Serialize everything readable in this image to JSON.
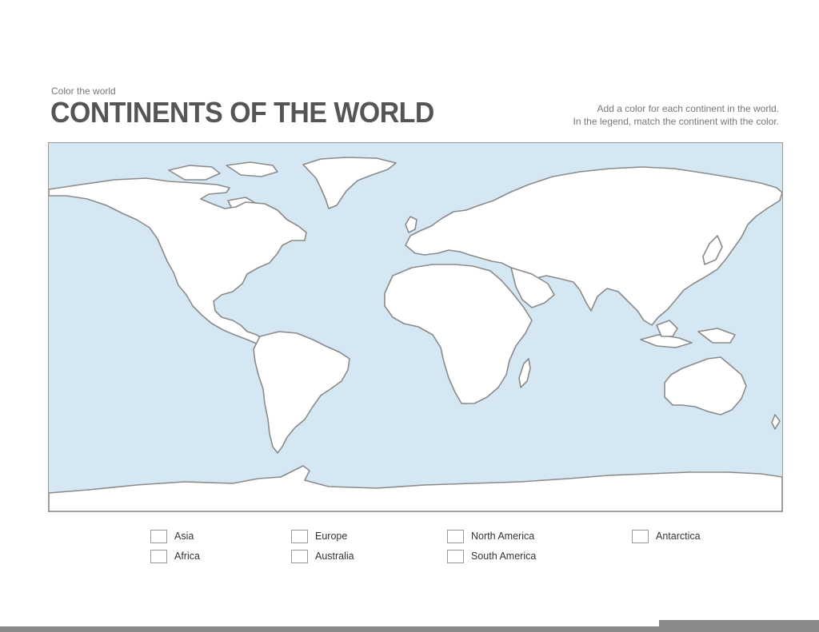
{
  "header": {
    "subtitle": "Color the world",
    "title": "CONTINENTS OF THE WORLD",
    "instruction_line1": "Add a color for each continent in the world.",
    "instruction_line2": "In the legend, match the continent with the color."
  },
  "map": {
    "ocean_color": "#d6e7f4",
    "land_color": "#ffffff",
    "coast_color": "#8a8a8a"
  },
  "legend": {
    "items": [
      {
        "label": "Asia"
      },
      {
        "label": "Africa"
      },
      {
        "label": "Europe"
      },
      {
        "label": "Australia"
      },
      {
        "label": "North America"
      },
      {
        "label": "South America"
      },
      {
        "label": "Antarctica"
      }
    ]
  }
}
